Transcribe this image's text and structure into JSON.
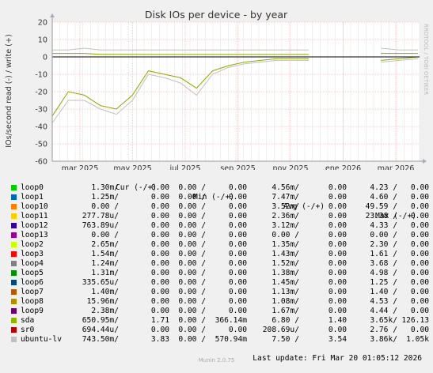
{
  "chart_data": {
    "type": "line",
    "title": "Disk IOs per device - by year",
    "ylabel": "IOs/second read (-) / write (+)",
    "ylim": [
      -60,
      20
    ],
    "yticks": [
      20,
      10,
      0,
      -10,
      -20,
      -30,
      -40,
      -50,
      -60
    ],
    "xtick_labels": [
      "mar 2025",
      "may 2025",
      "jul 2025",
      "sep 2025",
      "nov 2025",
      "ene 2026",
      "mar 2026"
    ],
    "grid": true,
    "watermark": "RRDTOOL / TOBI OETIKER",
    "series": [
      {
        "name": "sda",
        "color": "#8fa700",
        "read": [
          -34,
          -20,
          -22,
          -28,
          -30,
          -22,
          -8,
          -10,
          -12,
          -18,
          -8,
          -5,
          -3,
          -2,
          -1,
          -1,
          -1,
          -2,
          -1,
          0
        ],
        "write": [
          2,
          2,
          2,
          1.5,
          1.5,
          1.5,
          1.4,
          1.4,
          1.4,
          1.4,
          1.4,
          1.4,
          1.4,
          1.4,
          1.4,
          1.4,
          1.4,
          2,
          2,
          2
        ]
      },
      {
        "name": "ubuntu-lv",
        "color": "#c0c0c0",
        "read": [
          -38,
          -25,
          -25,
          -30,
          -33,
          -25,
          -10,
          -12,
          -15,
          -22,
          -10,
          -6,
          -4,
          -3,
          -2,
          -2,
          -2,
          -3,
          -2,
          -1
        ],
        "write": [
          4,
          4,
          5,
          4,
          4,
          4,
          4,
          4,
          4,
          4,
          4,
          4,
          4,
          4,
          4,
          4,
          4,
          5,
          4,
          4
        ]
      }
    ],
    "gap_from": "2025-11-20",
    "gap_to": "2026-01-05"
  },
  "legend": {
    "headers": {
      "cur": "Cur (-/+)",
      "min": "Min (-/+)",
      "avg": "Avg (-/+)",
      "max": "Max (-/+)"
    },
    "rows": [
      {
        "name": "loop0",
        "color": "#00cc00",
        "cur_r": "1.30m/",
        "cur_w": "0.00",
        "min_r": "0.00 /",
        "min_w": "0.00",
        "avg_r": "4.56m/",
        "avg_w": "0.00",
        "max_r": "4.23 /",
        "max_w": "0.00"
      },
      {
        "name": "loop1",
        "color": "#0066b3",
        "cur_r": "1.25m/",
        "cur_w": "0.00",
        "min_r": "0.00 /",
        "min_w": "0.00",
        "avg_r": "7.47m/",
        "avg_w": "0.00",
        "max_r": "4.60 /",
        "max_w": "0.00"
      },
      {
        "name": "loop10",
        "color": "#ff8000",
        "cur_r": "0.00 /",
        "cur_w": "0.00",
        "min_r": "0.00 /",
        "min_w": "0.00",
        "avg_r": "3.52m/",
        "avg_w": "0.00",
        "max_r": "49.59 /",
        "max_w": "0.00"
      },
      {
        "name": "loop11",
        "color": "#ffcc00",
        "cur_r": "277.78u/",
        "cur_w": "0.00",
        "min_r": "0.00 /",
        "min_w": "0.00",
        "avg_r": "2.36m/",
        "avg_w": "0.00",
        "max_r": "23.38 /",
        "max_w": "0.00"
      },
      {
        "name": "loop12",
        "color": "#330099",
        "cur_r": "763.89u/",
        "cur_w": "0.00",
        "min_r": "0.00 /",
        "min_w": "0.00",
        "avg_r": "3.12m/",
        "avg_w": "0.00",
        "max_r": "4.33 /",
        "max_w": "0.00"
      },
      {
        "name": "loop13",
        "color": "#990099",
        "cur_r": "0.00 /",
        "cur_w": "0.00",
        "min_r": "0.00 /",
        "min_w": "0.00",
        "avg_r": "0.00 /",
        "avg_w": "0.00",
        "max_r": "0.00 /",
        "max_w": "0.00"
      },
      {
        "name": "loop2",
        "color": "#ccff00",
        "cur_r": "2.65m/",
        "cur_w": "0.00",
        "min_r": "0.00 /",
        "min_w": "0.00",
        "avg_r": "1.35m/",
        "avg_w": "0.00",
        "max_r": "2.30 /",
        "max_w": "0.00"
      },
      {
        "name": "loop3",
        "color": "#ff0000",
        "cur_r": "1.54m/",
        "cur_w": "0.00",
        "min_r": "0.00 /",
        "min_w": "0.00",
        "avg_r": "1.43m/",
        "avg_w": "0.00",
        "max_r": "1.61 /",
        "max_w": "0.00"
      },
      {
        "name": "loop4",
        "color": "#808080",
        "cur_r": "1.24m/",
        "cur_w": "0.00",
        "min_r": "0.00 /",
        "min_w": "0.00",
        "avg_r": "1.52m/",
        "avg_w": "0.00",
        "max_r": "3.68 /",
        "max_w": "0.00"
      },
      {
        "name": "loop5",
        "color": "#008f00",
        "cur_r": "1.31m/",
        "cur_w": "0.00",
        "min_r": "0.00 /",
        "min_w": "0.00",
        "avg_r": "1.38m/",
        "avg_w": "0.00",
        "max_r": "4.98 /",
        "max_w": "0.00"
      },
      {
        "name": "loop6",
        "color": "#00487d",
        "cur_r": "335.65u/",
        "cur_w": "0.00",
        "min_r": "0.00 /",
        "min_w": "0.00",
        "avg_r": "1.45m/",
        "avg_w": "0.00",
        "max_r": "1.25 /",
        "max_w": "0.00"
      },
      {
        "name": "loop7",
        "color": "#b35a00",
        "cur_r": "1.40m/",
        "cur_w": "0.00",
        "min_r": "0.00 /",
        "min_w": "0.00",
        "avg_r": "1.13m/",
        "avg_w": "0.00",
        "max_r": "1.40 /",
        "max_w": "0.00"
      },
      {
        "name": "loop8",
        "color": "#b38f00",
        "cur_r": "15.96m/",
        "cur_w": "0.00",
        "min_r": "0.00 /",
        "min_w": "0.00",
        "avg_r": "1.08m/",
        "avg_w": "0.00",
        "max_r": "4.53 /",
        "max_w": "0.00"
      },
      {
        "name": "loop9",
        "color": "#6b006b",
        "cur_r": "2.38m/",
        "cur_w": "0.00",
        "min_r": "0.00 /",
        "min_w": "0.00",
        "avg_r": "1.67m/",
        "avg_w": "0.00",
        "max_r": "4.44 /",
        "max_w": "0.00"
      },
      {
        "name": "sda",
        "color": "#8fb300",
        "cur_r": "650.95m/",
        "cur_w": "1.71",
        "min_r": "0.00 /",
        "min_w": "366.14m",
        "avg_r": "6.80 /",
        "avg_w": "1.40",
        "max_r": "3.65k/",
        "max_w": "126.13"
      },
      {
        "name": "sr0",
        "color": "#b30000",
        "cur_r": "694.44u/",
        "cur_w": "0.00",
        "min_r": "0.00 /",
        "min_w": "0.00",
        "avg_r": "208.69u/",
        "avg_w": "0.00",
        "max_r": "2.76 /",
        "max_w": "0.00"
      },
      {
        "name": "ubuntu-lv",
        "color": "#bebebe",
        "cur_r": "743.50m/",
        "cur_w": "3.83",
        "min_r": "0.00 /",
        "min_w": "570.94m",
        "avg_r": "7.50 /",
        "avg_w": "3.54",
        "max_r": "3.86k/",
        "max_w": "1.05k"
      }
    ]
  },
  "last_update": "Last update: Fri Mar 20 01:05:12 2026",
  "footer": "Munin 2.0.75",
  "colors": {
    "background": "#f0f0f0",
    "plot_bg": "#ffffff",
    "grid_major": "#e8a0a0",
    "grid_minor": "#dddddd"
  }
}
